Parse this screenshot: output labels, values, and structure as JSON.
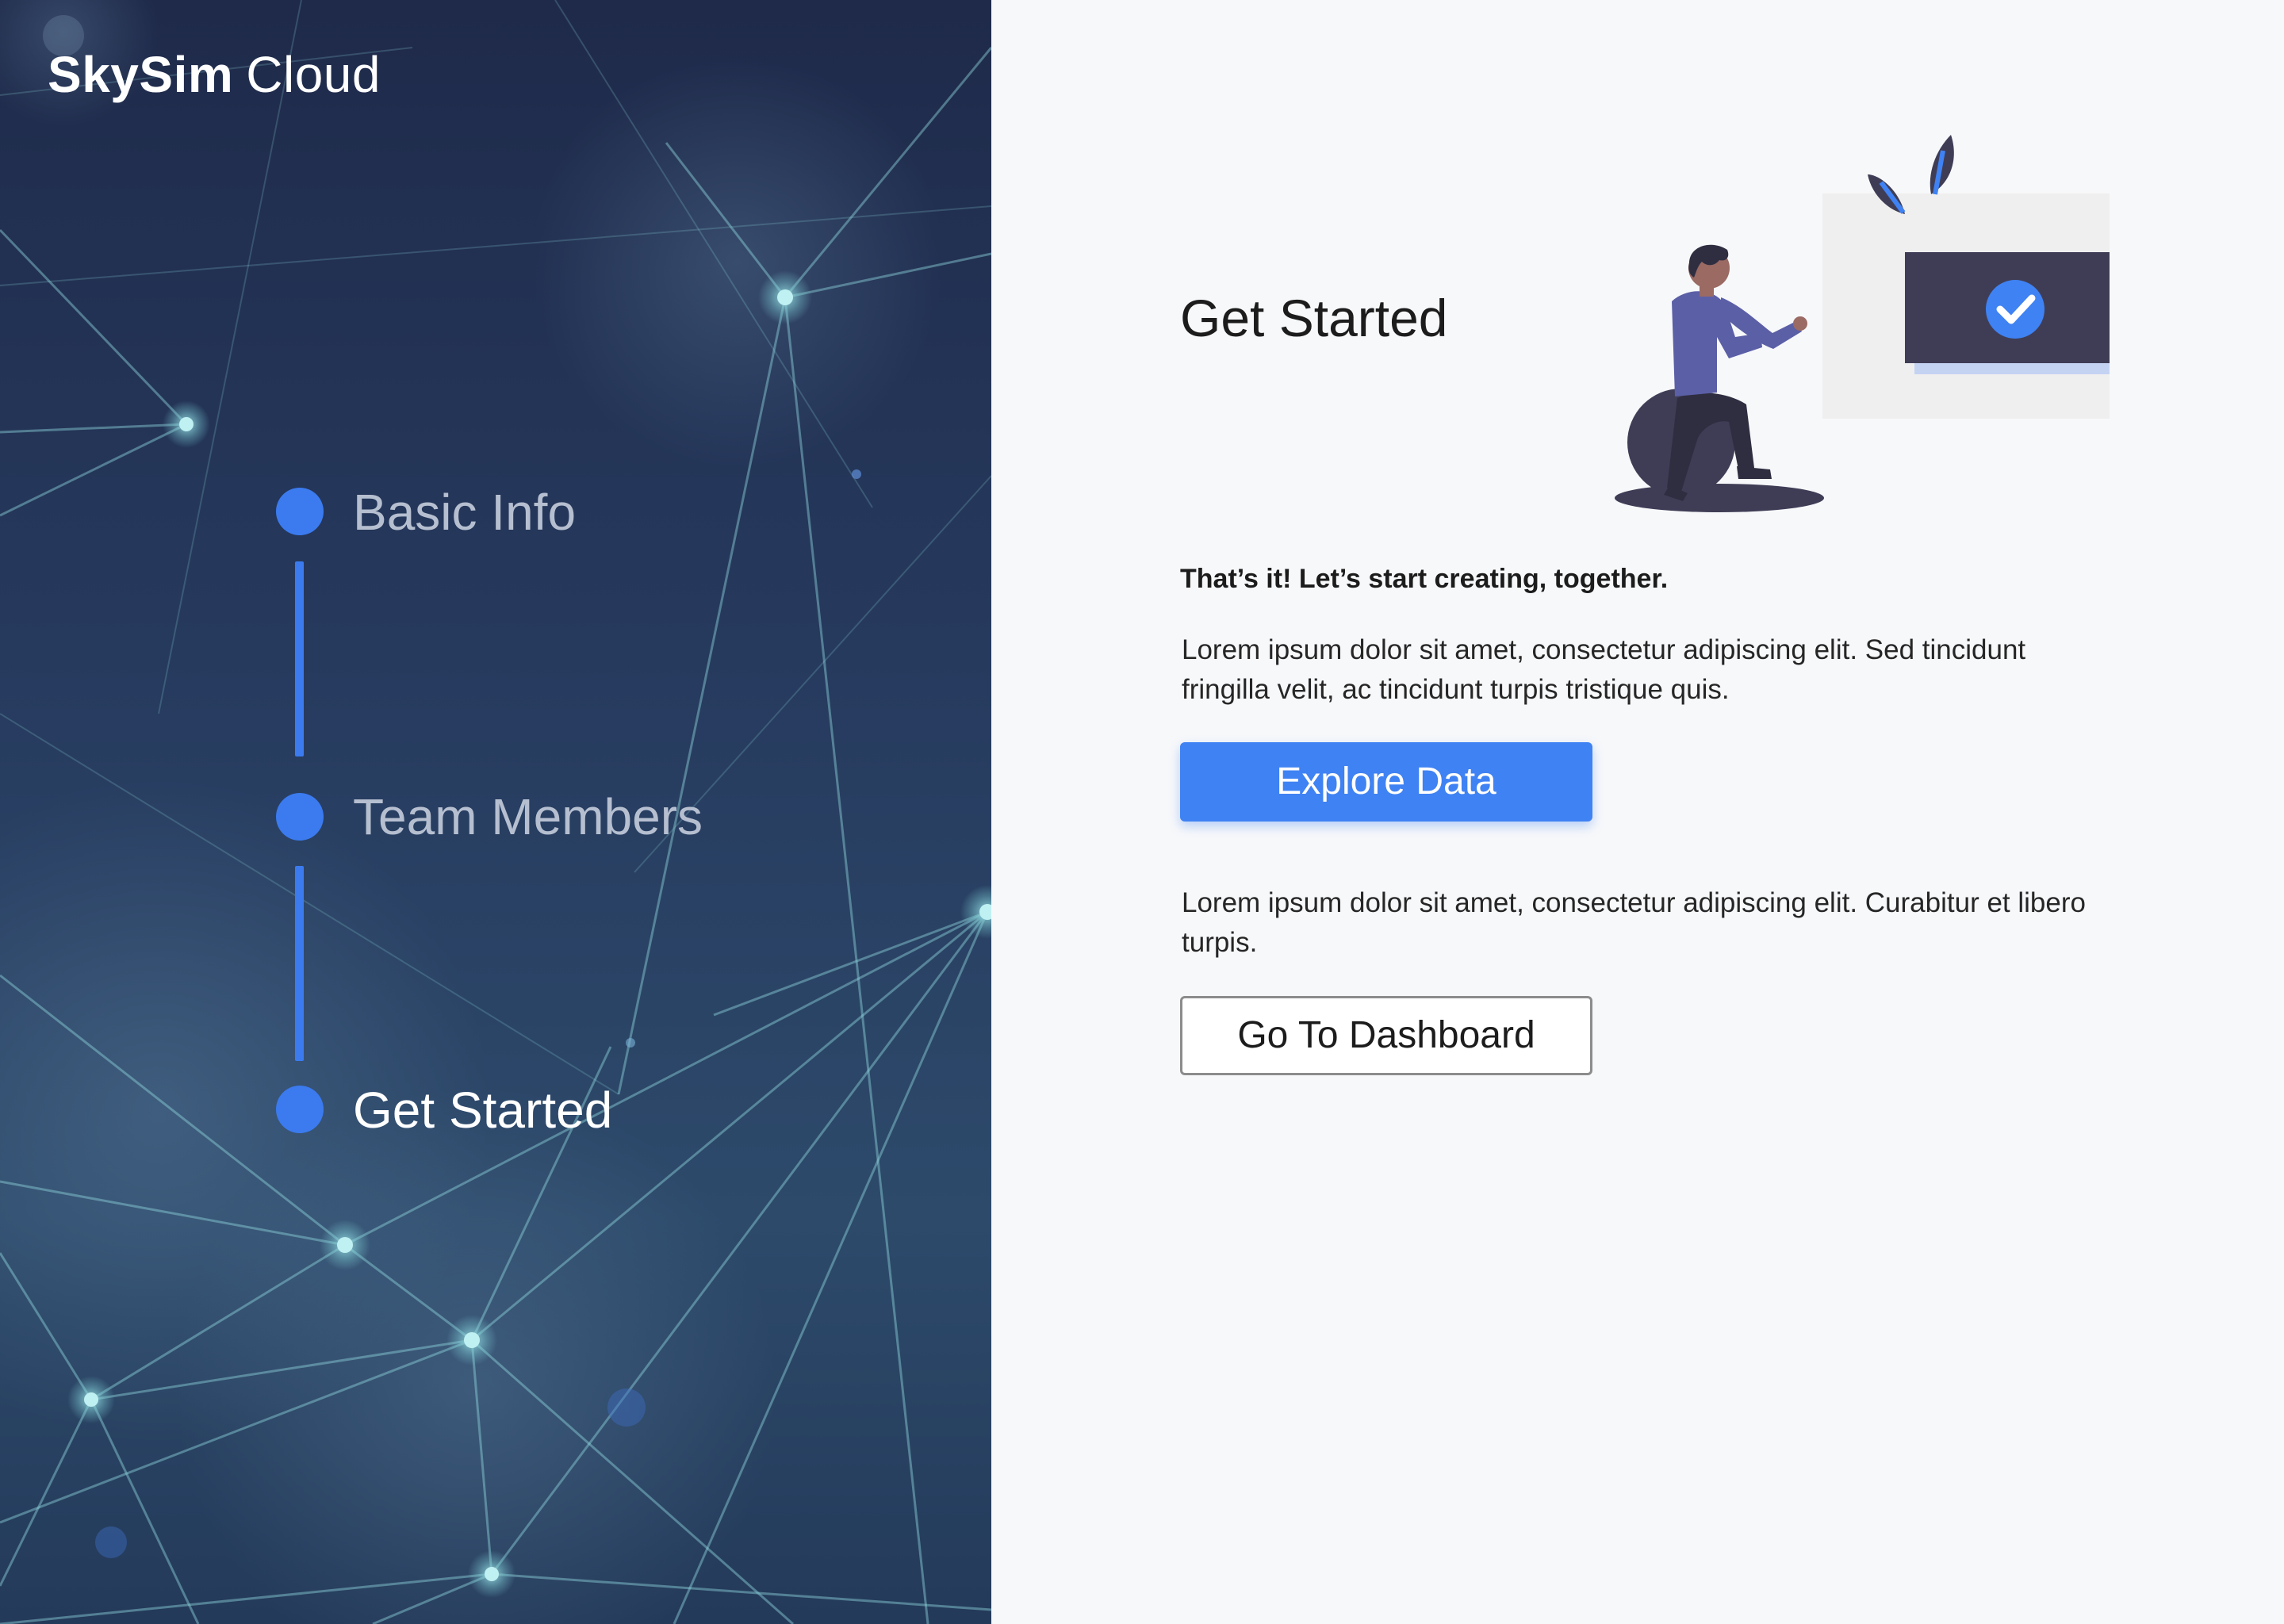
{
  "brand": {
    "name_bold": "SkySim",
    "name_light": "Cloud"
  },
  "stepper": {
    "steps": [
      {
        "label": "Basic Info",
        "state": "done"
      },
      {
        "label": "Team Members",
        "state": "done"
      },
      {
        "label": "Get Started",
        "state": "active"
      }
    ]
  },
  "main": {
    "title": "Get Started",
    "lead": "That’s it! Let’s start creating, together.",
    "paragraph_1": "Lorem ipsum dolor sit amet, consectetur adipiscing elit. Sed tincidunt fringilla velit, ac tincidunt turpis tristique quis.",
    "primary_button": "Explore Data",
    "paragraph_2": "Lorem ipsum dolor sit amet, consectetur adipiscing elit. Curabitur et libero turpis.",
    "secondary_button": "Go To Dashboard"
  },
  "illustration": {
    "icon": "check-icon",
    "description_icon": "person-at-screen-illustration"
  },
  "colors": {
    "accent": "#3f82f3",
    "left_panel_bg": "#243252",
    "right_panel_bg": "#f7f8fa",
    "text_dark": "#1c1c1c",
    "step_done_text": "#b6bfd0",
    "step_active_text": "#ffffff"
  }
}
